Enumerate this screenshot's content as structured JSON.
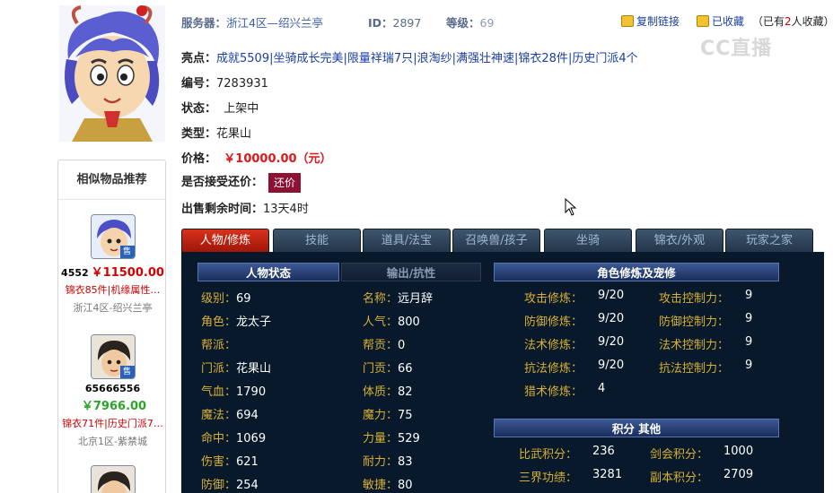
{
  "header": {
    "server_label": "服务器：",
    "server_value": "浙江4区—绍兴兰亭",
    "id_label": "ID：",
    "id_value": "2897",
    "level_label": "等级：",
    "level_value": "69",
    "copy_link": "复制链接",
    "favorited": "已收藏",
    "fav_count_prefix": "（已有",
    "fav_count": "2",
    "fav_count_suffix": "人收藏）",
    "watermark": "CC直播"
  },
  "info": {
    "highlights_label": "亮点：",
    "highlights": [
      "成就5509",
      "坐骑成长完美",
      "限量祥瑞7只",
      "浪淘纱",
      "满强壮神速",
      "锦衣28件",
      "历史门派4个"
    ],
    "number_label": "编号：",
    "number_value": "7283931",
    "status_label": "状态：",
    "status_value": "上架中",
    "type_label": "类型：",
    "type_value": "花果山",
    "price_label": "价格：",
    "price_value": "￥10000.00（元）",
    "bargain_label": "是否接受还价：",
    "bargain_button": "还价",
    "time_label": "出售剩余时间：",
    "time_value": "13天4时"
  },
  "sidebar": {
    "title": "相似物品推荐",
    "sale_badge": "售",
    "items": [
      {
        "id": "4552",
        "price": "￥11500.00",
        "desc": "锦衣85件|机缘属性…",
        "server": "浙江4区-绍兴兰亭",
        "price_color": "#d40000"
      },
      {
        "id": "65666556",
        "price": "￥7966.00",
        "desc": "锦衣71件|历史门派7…",
        "server": "北京1区-紫禁城",
        "price_color": "#2aa52a"
      }
    ]
  },
  "tabs": [
    {
      "label": "人物/修炼",
      "active": true
    },
    {
      "label": "技能",
      "active": false
    },
    {
      "label": "道具/法宝",
      "active": false
    },
    {
      "label": "召唤兽/孩子",
      "active": false
    },
    {
      "label": "坐骑",
      "active": false
    },
    {
      "label": "锦衣/外观",
      "active": false
    },
    {
      "label": "玩家之家",
      "active": false
    }
  ],
  "panel": {
    "status_tab": "人物状态",
    "resist_tab": "输出/抗性",
    "cultivation_title": "角色修炼及宠修",
    "points_title": "积分 其他",
    "stats_left": [
      {
        "k": "级别：",
        "v": "69"
      },
      {
        "k": "角色：",
        "v": "龙太子"
      },
      {
        "k": "帮派：",
        "v": ""
      },
      {
        "k": "门派：",
        "v": "花果山"
      },
      {
        "k": "气血：",
        "v": "1790"
      },
      {
        "k": "魔法：",
        "v": "694"
      },
      {
        "k": "命中：",
        "v": "1069"
      },
      {
        "k": "伤害：",
        "v": "621"
      },
      {
        "k": "防御：",
        "v": "254"
      }
    ],
    "stats_right": [
      {
        "k": "名称：",
        "v": "远月辞"
      },
      {
        "k": "人气：",
        "v": "800"
      },
      {
        "k": "帮贡：",
        "v": "0"
      },
      {
        "k": "门贡：",
        "v": "66"
      },
      {
        "k": "体质：",
        "v": "82"
      },
      {
        "k": "魔力：",
        "v": "75"
      },
      {
        "k": "力量：",
        "v": "529"
      },
      {
        "k": "耐力：",
        "v": "83"
      },
      {
        "k": "敏捷：",
        "v": "80"
      }
    ],
    "cultivation_left": [
      {
        "k": "攻击修炼：",
        "v": "9/20"
      },
      {
        "k": "防御修炼：",
        "v": "9/20"
      },
      {
        "k": "法术修炼：",
        "v": "9/20"
      },
      {
        "k": "抗法修炼：",
        "v": "9/20"
      },
      {
        "k": "猎术修炼：",
        "v": "4"
      }
    ],
    "cultivation_right": [
      {
        "k": "攻击控制力：",
        "v": "9"
      },
      {
        "k": "防御控制力：",
        "v": "9"
      },
      {
        "k": "法术控制力：",
        "v": "9"
      },
      {
        "k": "抗法控制力：",
        "v": "9"
      }
    ],
    "points": [
      {
        "k": "比武积分：",
        "v": "236"
      },
      {
        "k": "剑会积分：",
        "v": "1000"
      },
      {
        "k": "三界功绩：",
        "v": "3281"
      },
      {
        "k": "副本积分：",
        "v": "2709"
      }
    ]
  }
}
